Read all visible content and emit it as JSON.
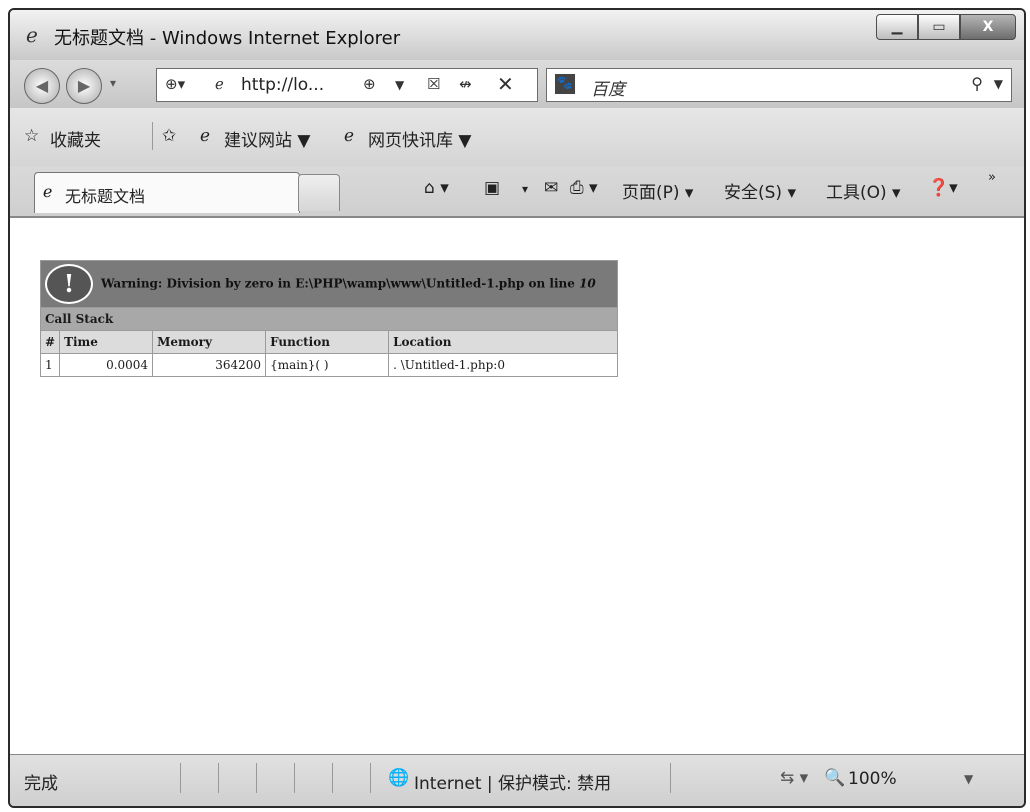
{
  "window": {
    "title": "无标题文档 - Windows Internet Explorer",
    "minimize_icon": "minimize-icon",
    "maximize_icon": "maximize-icon",
    "close_icon": "close-icon",
    "close_label": "X"
  },
  "address": {
    "url": "http://lo...",
    "search_placeholder": "百度"
  },
  "favorites": {
    "label": "收藏夹",
    "items": [
      {
        "label": "建议网站 ▼"
      },
      {
        "label": "网页快讯库 ▼"
      }
    ]
  },
  "tab": {
    "title": "无标题文档"
  },
  "toolbar": {
    "page": "页面(P) ▾",
    "safety": "安全(S) ▾",
    "tools": "工具(O) ▾",
    "more": "»"
  },
  "error": {
    "bang": "!",
    "message": "Warning: Division by zero in E:\\PHP\\wamp\\www\\Untitled-1.php on line",
    "line": "10",
    "call_stack_label": "Call Stack",
    "columns": [
      "#",
      "Time",
      "Memory",
      "Function",
      "Location"
    ],
    "rows": [
      {
        "num": "1",
        "time": "0.0004",
        "memory": "364200",
        "function": "{main}( )",
        "location": ". \\Untitled-1.php:0"
      }
    ]
  },
  "status": {
    "text": "完成",
    "zone": "Internet | 保护模式: 禁用",
    "zoom": "100%"
  }
}
